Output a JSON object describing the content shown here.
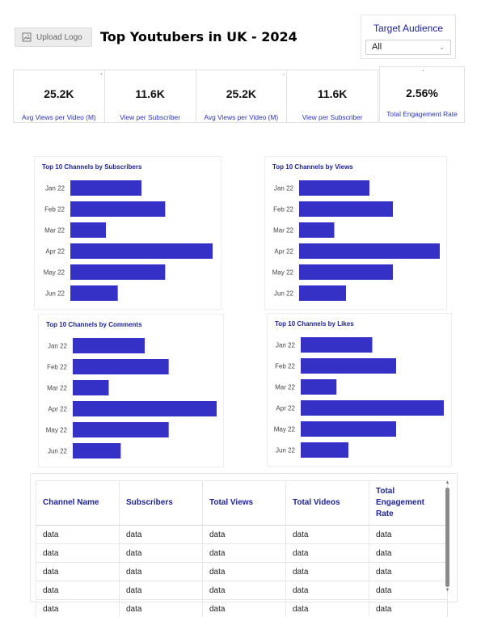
{
  "header": {
    "upload_logo_label": "Upload Logo",
    "title": "Top Youtubers in UK - 2024"
  },
  "filter": {
    "title": "Target Audience",
    "selected": "All"
  },
  "kpis": [
    {
      "value": "25.2K",
      "label": "Avg Views per Video (M)"
    },
    {
      "value": "11.6K",
      "label": "View per Subscriber"
    },
    {
      "value": "25.2K",
      "label": "Avg Views per Video (M)"
    },
    {
      "value": "11.6K",
      "label": "View per Subscriber"
    }
  ],
  "kpi_engagement": {
    "value": "2.56%",
    "label": "Total Engagement Rate"
  },
  "colors": {
    "bar": "#3530c6",
    "title": "#1f2390",
    "kpi_label": "#2b33b8"
  },
  "chart_data": [
    {
      "type": "bar",
      "orientation": "horizontal",
      "title": "Top 10 Channels by Subscribers",
      "categories": [
        "Jan 22",
        "Feb 22",
        "Mar 22",
        "Apr 22",
        "May 22",
        "Jun 22"
      ],
      "values": [
        15,
        20,
        7.5,
        30,
        20,
        10
      ],
      "xlim": [
        0,
        30
      ]
    },
    {
      "type": "bar",
      "orientation": "horizontal",
      "title": "Top 10 Channels by Views",
      "categories": [
        "Jan 22",
        "Feb 22",
        "Mar 22",
        "Apr 22",
        "May 22",
        "Jun 22"
      ],
      "values": [
        15,
        20,
        7.5,
        30,
        20,
        10
      ],
      "xlim": [
        0,
        30
      ]
    },
    {
      "type": "bar",
      "orientation": "horizontal",
      "title": "Top 10 Channels by Comments",
      "categories": [
        "Jan 22",
        "Feb 22",
        "Mar 22",
        "Apr 22",
        "May 22",
        "Jun 22"
      ],
      "values": [
        15,
        20,
        7.5,
        30,
        20,
        10
      ],
      "xlim": [
        0,
        30
      ]
    },
    {
      "type": "bar",
      "orientation": "horizontal",
      "title": "Top 10 Channels by Likes",
      "categories": [
        "Jan 22",
        "Feb 22",
        "Mar 22",
        "Apr 22",
        "May 22",
        "Jun 22"
      ],
      "values": [
        15,
        20,
        7.5,
        30,
        20,
        10
      ],
      "xlim": [
        0,
        30
      ]
    }
  ],
  "table": {
    "columns": [
      "Channel Name",
      "Subscribers",
      "Total Views",
      "Total Videos",
      "Total Engagement Rate"
    ],
    "rows": [
      [
        "data",
        "data",
        "data",
        "data",
        "data"
      ],
      [
        "data",
        "data",
        "data",
        "data",
        "data"
      ],
      [
        "data",
        "data",
        "data",
        "data",
        "data"
      ],
      [
        "data",
        "data",
        "data",
        "data",
        "data"
      ],
      [
        "data",
        "data",
        "data",
        "data",
        "data"
      ]
    ]
  }
}
